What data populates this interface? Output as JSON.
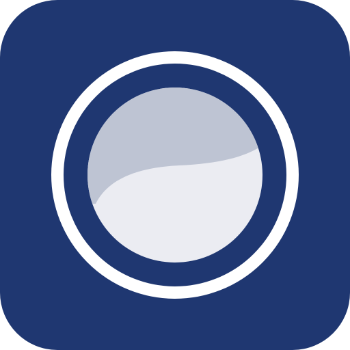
{
  "icon": {
    "name": "lens-aperture-app-icon",
    "colors": {
      "background": "#1F3771",
      "ring": "#FFFFFF",
      "inner_highlight": "#BEC4D3",
      "inner_body": "#EBECF2"
    }
  }
}
